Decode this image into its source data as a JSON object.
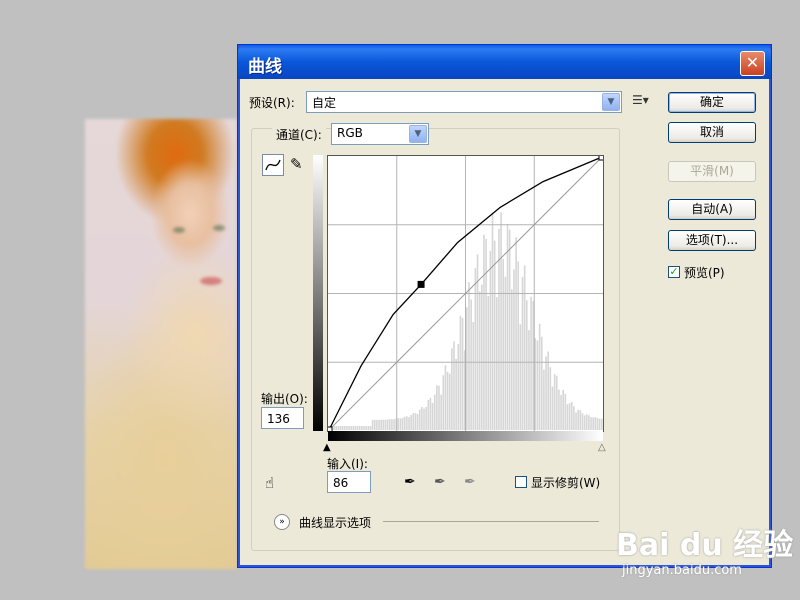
{
  "dialog": {
    "title": "曲线",
    "close_label": "✕",
    "preset_label": "预设(R):",
    "preset_value": "自定",
    "channel_label": "通道(C):",
    "channel_value": "RGB",
    "output_label": "输出(O):",
    "output_value": "136",
    "input_label": "输入(I):",
    "input_value": "86",
    "show_clipping_label": "显示修剪(W)",
    "curve_display_options_label": "曲线显示选项",
    "buttons": {
      "ok": "确定",
      "cancel": "取消",
      "smooth": "平滑(M)",
      "auto": "自动(A)",
      "options": "选项(T)...",
      "preview": "预览(P)"
    },
    "preview_checked": true,
    "show_clipping_checked": false
  },
  "watermark": {
    "brand": "Bai du 经验",
    "url": "jingyan.baidu.com"
  },
  "chart_data": {
    "type": "line",
    "xlim": [
      0,
      255
    ],
    "ylim": [
      0,
      255
    ],
    "grid": true,
    "series": [
      {
        "values": [
          [
            0,
            0
          ],
          [
            30,
            60
          ],
          [
            60,
            108
          ],
          [
            86,
            136
          ],
          [
            120,
            175
          ],
          [
            160,
            208
          ],
          [
            200,
            232
          ],
          [
            255,
            255
          ]
        ]
      },
      {
        "values": [
          [
            0,
            0
          ],
          [
            255,
            255
          ]
        ]
      }
    ],
    "control_points": [
      [
        0,
        0
      ],
      [
        86,
        136
      ],
      [
        255,
        255
      ]
    ]
  },
  "colors": {
    "titlebar": "#0a57da",
    "dialog_bg": "#ece9d8",
    "close_button": "#c94122"
  }
}
